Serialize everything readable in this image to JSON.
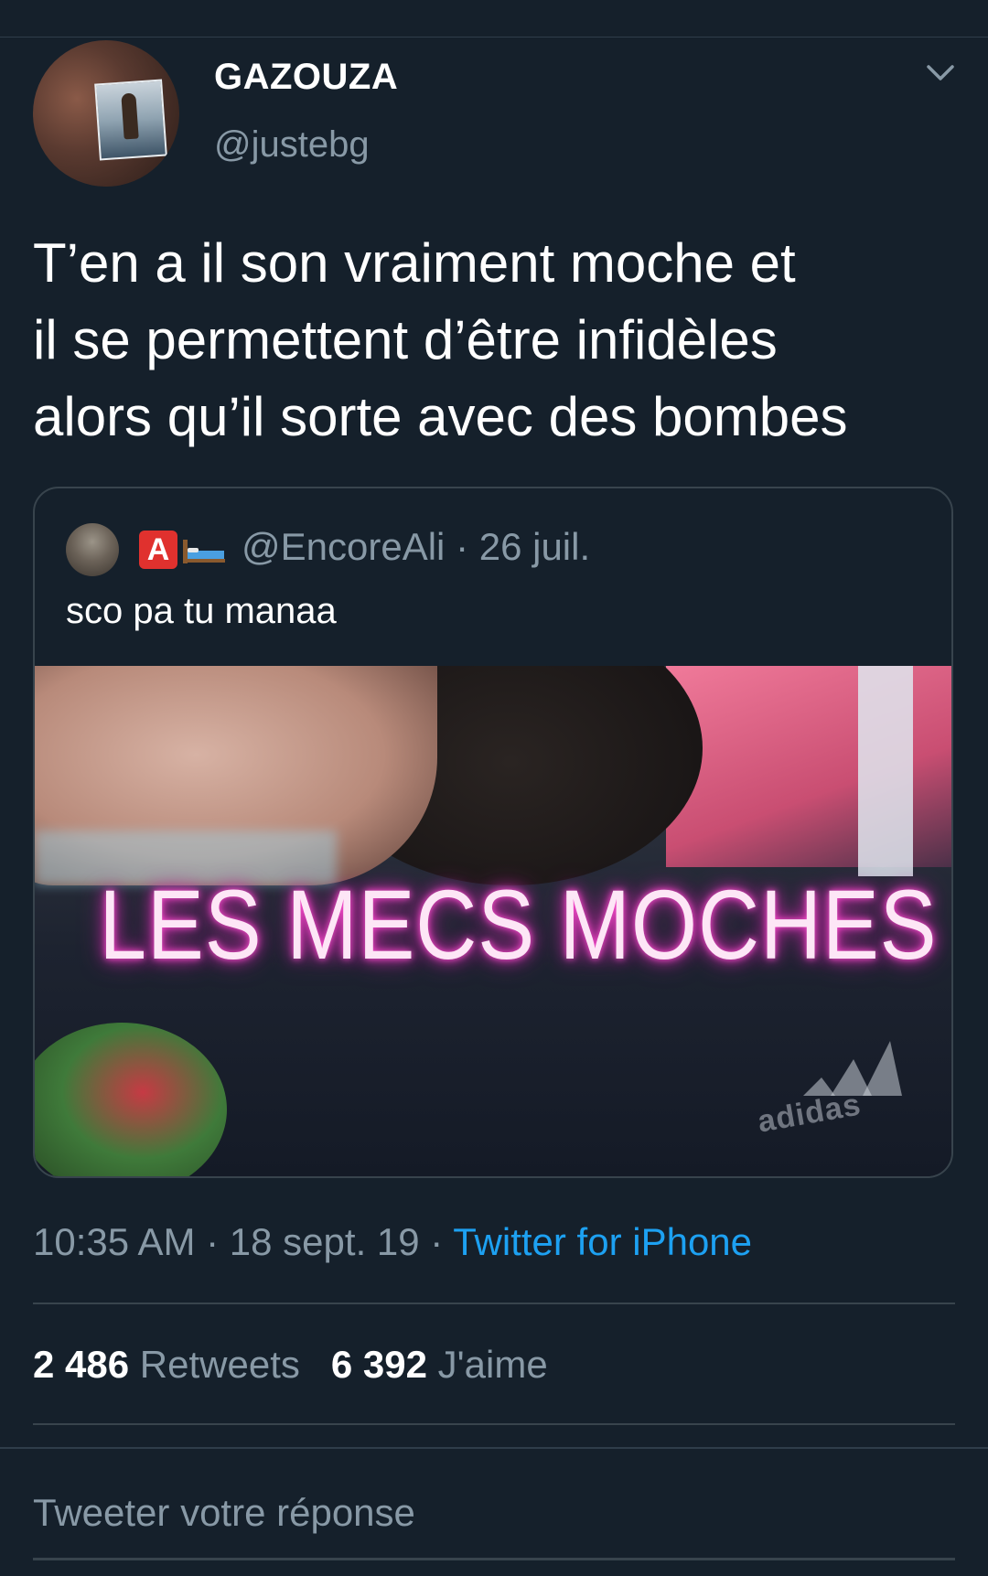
{
  "author": {
    "display_name": "GAZOUZA",
    "handle": "@justebg"
  },
  "tweet": {
    "lines": [
      "T’en a il son vraiment moche et",
      "il se permettent d’être infidèles",
      "alors qu’il sorte avec des bombes"
    ]
  },
  "quoted_tweet": {
    "emoji_letter": "A",
    "handle": "@EncoreAli",
    "separator": "·",
    "date": "26 juil.",
    "text": "sco pa tu manaa",
    "image_caption": "LES MECS MOCHES",
    "image_brand_text": "adidas"
  },
  "meta": {
    "time": "10:35 AM",
    "sep1": " · ",
    "date": "18 sept. 19",
    "sep2": " · ",
    "source": "Twitter for iPhone"
  },
  "stats": {
    "retweets_count": "2 486",
    "retweets_label": "Retweets",
    "likes_count": "6 392",
    "likes_label": "J'aime"
  },
  "reply": {
    "placeholder": "Tweeter votre réponse"
  },
  "colors": {
    "background": "#15202b",
    "muted": "#8899a6",
    "link": "#1da1f2",
    "border": "#38444d"
  }
}
